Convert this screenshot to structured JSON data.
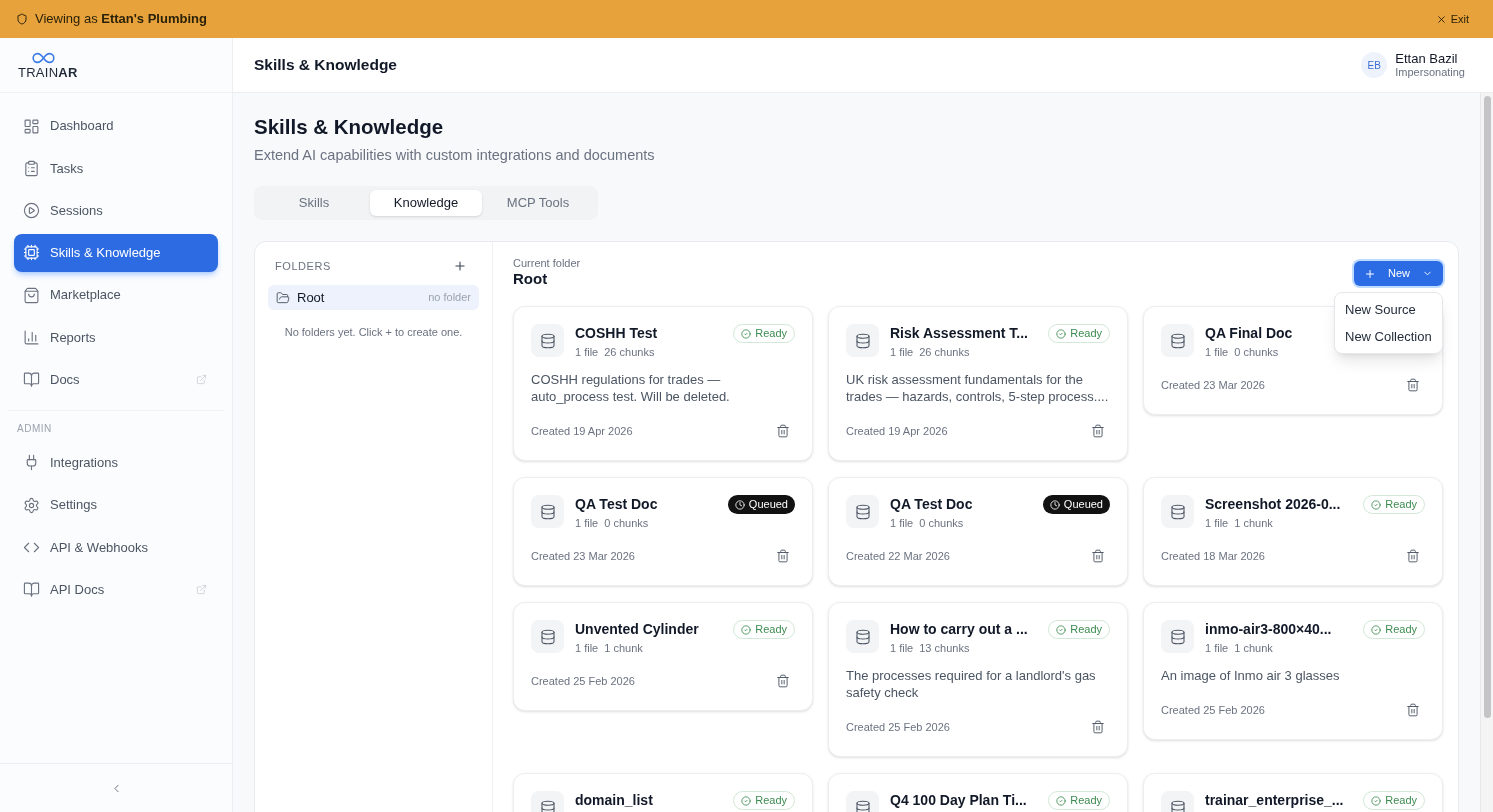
{
  "banner": {
    "text": "Viewing as **Ettan's Plumbing**",
    "exit_label": "Exit"
  },
  "sidebar": {
    "logo": "TRAIN**AR**",
    "items": [
      {
        "label": "Dashboard",
        "selected": false,
        "external": false
      },
      {
        "label": "Tasks",
        "selected": false,
        "external": false
      },
      {
        "label": "Sessions",
        "selected": false,
        "external": false
      },
      {
        "label": "Skills & Knowledge",
        "selected": true,
        "external": false
      },
      {
        "label": "Marketplace",
        "selected": false,
        "external": false
      },
      {
        "label": "Reports",
        "selected": false,
        "external": false
      },
      {
        "label": "Docs",
        "selected": false,
        "external": true
      }
    ],
    "admin_heading": "ADMIN",
    "admin_items": [
      {
        "label": "Integrations",
        "selected": false,
        "external": false
      },
      {
        "label": "Settings",
        "selected": false,
        "external": false
      },
      {
        "label": "API & Webhooks",
        "selected": false,
        "external": false
      },
      {
        "label": "API Docs",
        "selected": false,
        "external": true
      }
    ]
  },
  "header": {
    "title": "Skills & Knowledge",
    "user": {
      "initials": "EB",
      "name": "Ettan Bazil",
      "role": "Impersonating"
    }
  },
  "page": {
    "title": "Skills & Knowledge",
    "subtitle": "Extend AI capabilities with custom integrations and documents"
  },
  "tabs": [
    {
      "label": "Skills",
      "selected": false
    },
    {
      "label": "Knowledge",
      "selected": true
    },
    {
      "label": "MCP Tools",
      "selected": false
    }
  ],
  "folders": {
    "heading": "FOLDERS",
    "items": [
      {
        "name": "Root",
        "note": "no folder",
        "selected": true
      }
    ],
    "empty_message": "No folders yet. Click + to create one."
  },
  "current_folder": {
    "label": "Current folder",
    "name": "Root"
  },
  "new_button": {
    "label": "New",
    "expanded": true,
    "menu": [
      "New Source",
      "New Collection"
    ]
  },
  "cards": [
    {
      "title": "COSHH Test",
      "files": "1 file",
      "chunks": "26 chunks",
      "status": {
        "kind": "ready",
        "label": "Ready"
      },
      "description": "COSHH regulations for trades — auto_process test. Will be deleted.",
      "created": "Created 19 Apr 2026"
    },
    {
      "title": "Risk Assessment T...",
      "files": "1 file",
      "chunks": "26 chunks",
      "status": {
        "kind": "ready",
        "label": "Ready"
      },
      "description": "UK risk assessment fundamentals for the trades — hazards, controls, 5-step process....",
      "created": "Created 19 Apr 2026"
    },
    {
      "title": "QA Final Doc",
      "files": "1 file",
      "chunks": "0 chunks",
      "created": "Created 23 Mar 2026"
    },
    {
      "title": "QA Test Doc",
      "files": "1 file",
      "chunks": "0 chunks",
      "status": {
        "kind": "queued",
        "label": "Queued"
      },
      "created": "Created 23 Mar 2026"
    },
    {
      "title": "QA Test Doc",
      "files": "1 file",
      "chunks": "0 chunks",
      "status": {
        "kind": "queued",
        "label": "Queued"
      },
      "created": "Created 22 Mar 2026"
    },
    {
      "title": "Screenshot 2026-0...",
      "files": "1 file",
      "chunks": "1 chunk",
      "status": {
        "kind": "ready",
        "label": "Ready"
      },
      "created": "Created 18 Mar 2026"
    },
    {
      "title": "Unvented Cylinder",
      "files": "1 file",
      "chunks": "1 chunk",
      "status": {
        "kind": "ready",
        "label": "Ready"
      },
      "created": "Created 25 Feb 2026"
    },
    {
      "title": "How to carry out a ...",
      "files": "1 file",
      "chunks": "13 chunks",
      "status": {
        "kind": "ready",
        "label": "Ready"
      },
      "description": "The processes required for a landlord's gas safety check",
      "created": "Created 25 Feb 2026"
    },
    {
      "title": "inmo-air3-800×40...",
      "files": "1 file",
      "chunks": "1 chunk",
      "status": {
        "kind": "ready",
        "label": "Ready"
      },
      "description": "An image of Inmo air 3 glasses",
      "created": "Created 25 Feb 2026"
    },
    {
      "title": "domain_list",
      "status": {
        "kind": "ready",
        "label": "Ready"
      }
    },
    {
      "title": "Q4 100 Day Plan Ti...",
      "status": {
        "kind": "ready",
        "label": "Ready"
      }
    },
    {
      "title": "trainar_enterprise_...",
      "status": {
        "kind": "ready",
        "label": "Ready"
      }
    }
  ]
}
